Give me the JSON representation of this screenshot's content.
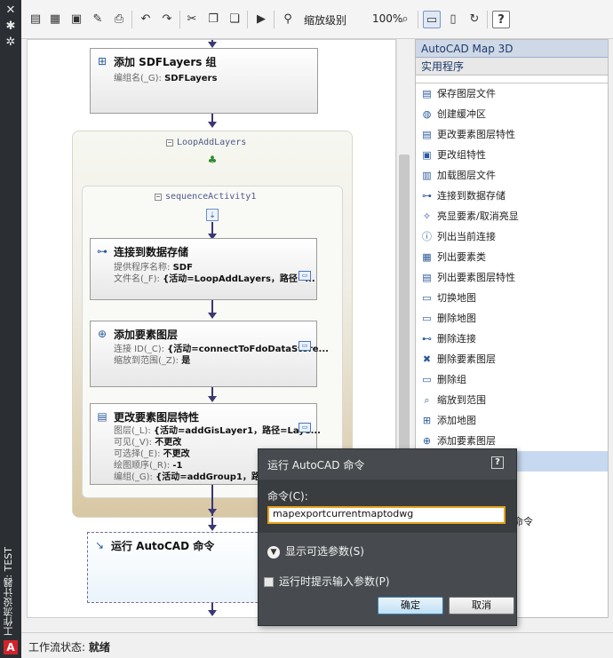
{
  "side_strip": {
    "close_glyph": "✕",
    "pin_glyph": "✱",
    "settings_glyph": "✲",
    "title": "工作流设计器: TEST",
    "logo_letter": "A"
  },
  "toolbar": {
    "zoom_label": "缩放级别",
    "zoom_value": "100%",
    "help_glyph": "?"
  },
  "canvas": {
    "activities": [
      {
        "title": "添加 SDFLayers 组",
        "props": [
          {
            "label": "编组名(_G): ",
            "value": "SDFLayers"
          }
        ]
      },
      {
        "title": "连接到数据存储",
        "props": [
          {
            "label": "提供程序名称: ",
            "value": "SDF"
          },
          {
            "label": "文件名(_F): ",
            "value": "{活动=LoopAddLayers，路径=..."
          }
        ]
      },
      {
        "title": "添加要素图层",
        "props": [
          {
            "label": "连接 ID(_C): ",
            "value": "{活动=connectToFdoDataStore..."
          },
          {
            "label": "缩放到范围(_Z): ",
            "value": "是"
          }
        ]
      },
      {
        "title": "更改要素图层特性",
        "props": [
          {
            "label": "图层(_L): ",
            "value": "{活动=addGisLayer1，路径=Laye..."
          },
          {
            "label": "可见(_V): ",
            "value": "不更改"
          },
          {
            "label": "可选择(_E): ",
            "value": "不更改"
          },
          {
            "label": "绘图顺序(_R): ",
            "value": "-1"
          },
          {
            "label": "编组(_G): ",
            "value": "{活动=addGroup1，路径"
          }
        ]
      },
      {
        "title": "运行 AutoCAD 命令",
        "props": []
      }
    ],
    "loop_title": "LoopAddLayers",
    "sequence_title": "sequenceActivity1"
  },
  "panel": {
    "header": "AutoCAD Map 3D",
    "subheader": "实用程序",
    "items": [
      {
        "label": "保存图层文件",
        "icon": "save-layer-icon"
      },
      {
        "label": "创建缓冲区",
        "icon": "buffer-icon"
      },
      {
        "label": "更改要素图层特性",
        "icon": "layer-props-icon"
      },
      {
        "label": "更改组特性",
        "icon": "group-props-icon"
      },
      {
        "label": "加载图层文件",
        "icon": "load-layer-icon"
      },
      {
        "label": "连接到数据存储",
        "icon": "connect-icon"
      },
      {
        "label": "亮显要素/取消亮显",
        "icon": "highlight-icon"
      },
      {
        "label": "列出当前连接",
        "icon": "info-icon"
      },
      {
        "label": "列出要素类",
        "icon": "feature-class-icon"
      },
      {
        "label": "列出要素图层特性",
        "icon": "list-props-icon"
      },
      {
        "label": "切换地图",
        "icon": "switch-map-icon"
      },
      {
        "label": "删除地图",
        "icon": "delete-map-icon"
      },
      {
        "label": "删除连接",
        "icon": "delete-connection-icon"
      },
      {
        "label": "删除要素图层",
        "icon": "delete-layer-icon"
      },
      {
        "label": "删除组",
        "icon": "delete-group-icon"
      },
      {
        "label": "缩放到范围",
        "icon": "zoom-extents-icon"
      },
      {
        "label": "添加地图",
        "icon": "add-map-icon"
      },
      {
        "label": "添加要素图层",
        "icon": "add-layer-icon"
      }
    ],
    "partial_text": "命令"
  },
  "status": {
    "label": "工作流状态: ",
    "value": "就绪"
  },
  "dialog": {
    "title": "运行 AutoCAD 命令",
    "help": "?",
    "command_label": "命令(C):",
    "command_value": "mapexportcurrentmaptodwg",
    "expander_label": "显示可选参数(S)",
    "checkbox_label": "运行时提示输入参数(P)",
    "ok_label": "确定",
    "cancel_label": "取消"
  },
  "colors": {
    "accent": "#e6a219",
    "connector": "#3b3775",
    "dialog_bg": "#474b4f"
  }
}
